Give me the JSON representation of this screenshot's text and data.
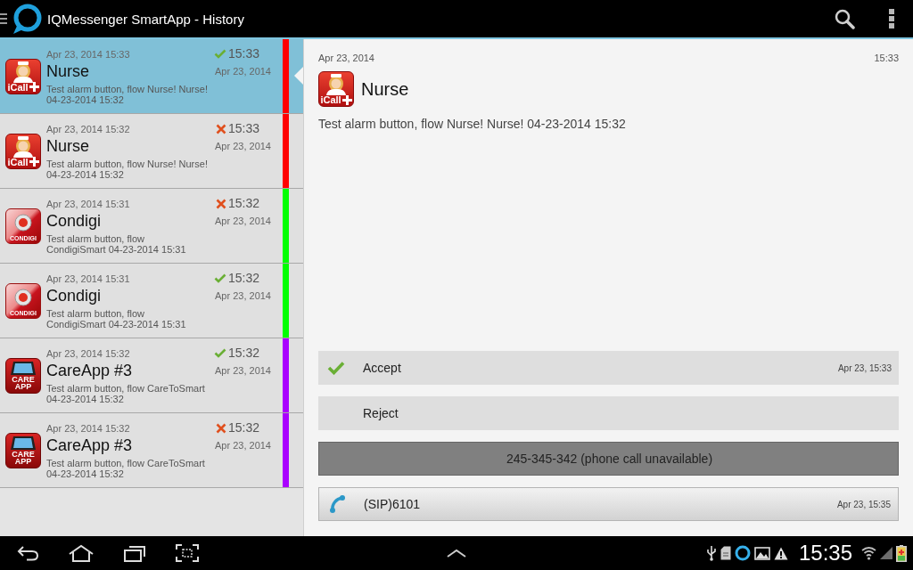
{
  "app_bar": {
    "title": "IQMessenger SmartApp - History"
  },
  "history": [
    {
      "kind": "icall",
      "logo_text": "iCall",
      "received": "Apr 23, 2014 15:33",
      "name": "Nurse",
      "message": "Test alarm button, flow Nurse! Nurse!\n04-23-2014 15:32",
      "accepted": true,
      "time": "15:33",
      "date": "Apr 23, 2014",
      "color": "#ff0000",
      "selected": true
    },
    {
      "kind": "icall",
      "logo_text": "iCall",
      "received": "Apr 23, 2014 15:32",
      "name": "Nurse",
      "message": "Test alarm button, flow Nurse! Nurse!\n04-23-2014 15:32",
      "accepted": false,
      "time": "15:33",
      "date": "Apr 23, 2014",
      "color": "#ff0000",
      "selected": false
    },
    {
      "kind": "condigi",
      "logo_text": "CONDIGI",
      "received": "Apr 23, 2014 15:31",
      "name": "Condigi",
      "message": "Test alarm button, flow\nCondigiSmart 04-23-2014 15:31",
      "accepted": false,
      "time": "15:32",
      "date": "Apr 23, 2014",
      "color": "#00ff00",
      "selected": false
    },
    {
      "kind": "condigi",
      "logo_text": "CONDIGI",
      "received": "Apr 23, 2014 15:31",
      "name": "Condigi",
      "message": "Test alarm button, flow\nCondigiSmart 04-23-2014 15:31",
      "accepted": true,
      "time": "15:32",
      "date": "Apr 23, 2014",
      "color": "#00ff00",
      "selected": false
    },
    {
      "kind": "careapp",
      "logo_text": "CARE APP",
      "received": "Apr 23, 2014 15:32",
      "name": "CareApp #3",
      "message": "Test alarm button, flow CareToSmart\n04-23-2014 15:32",
      "accepted": true,
      "time": "15:32",
      "date": "Apr 23, 2014",
      "color": "#aa00ff",
      "selected": false
    },
    {
      "kind": "careapp",
      "logo_text": "CARE APP",
      "received": "Apr 23, 2014 15:32",
      "name": "CareApp #3",
      "message": "Test alarm button, flow CareToSmart\n04-23-2014 15:32",
      "accepted": false,
      "time": "15:32",
      "date": "Apr 23, 2014",
      "color": "#aa00ff",
      "selected": false
    }
  ],
  "detail": {
    "date": "Apr 23, 2014",
    "time": "15:33",
    "kind": "icall",
    "logo_text": "iCall",
    "name": "Nurse",
    "message": "Test alarm button, flow Nurse! Nurse! 04-23-2014 15:32",
    "actions": [
      {
        "kind": "response",
        "label": "Accept",
        "chosen": true,
        "time": "Apr 23, 15:33"
      },
      {
        "kind": "response",
        "label": "Reject",
        "chosen": false
      },
      {
        "kind": "call",
        "label": "245-345-342 (phone call unavailable)",
        "disabled": true
      },
      {
        "kind": "call",
        "label": "(SIP)6101",
        "disabled": false,
        "time": "Apr 23, 15:35"
      }
    ]
  },
  "nav_bar": {
    "clock": "15:35"
  }
}
